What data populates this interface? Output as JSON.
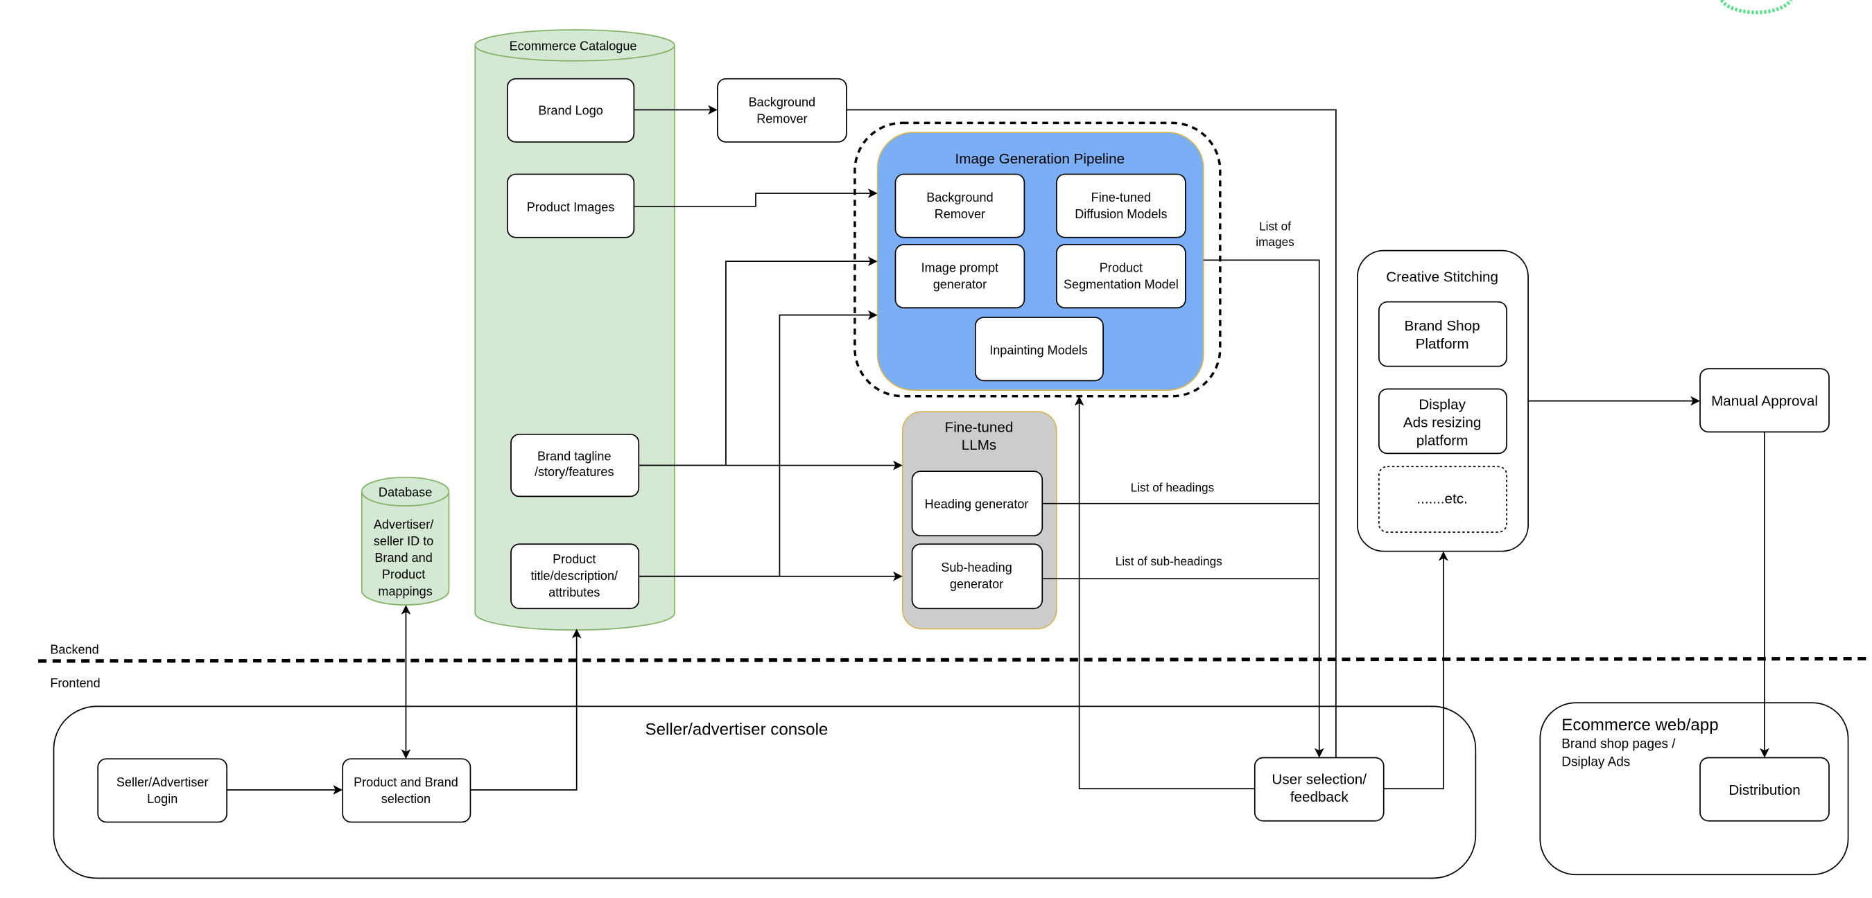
{
  "colors": {
    "catalogue_fill": "#d5e8d4",
    "catalogue_stroke": "#82b366",
    "pipeline_fill": "#7aaef5",
    "pipeline_stroke": "#d6b656",
    "llm_fill": "#cccccc",
    "llm_stroke": "#d6b656"
  },
  "catalogue": {
    "title": "Ecommerce Catalogue",
    "brand_logo": [
      "Brand Logo"
    ],
    "product_images": [
      "Product Images"
    ],
    "brand_tagline": [
      "Brand tagline",
      "/story/features"
    ],
    "product_title": [
      "Product",
      "title/description/",
      "attributes"
    ]
  },
  "bg_remover_outer": [
    "Background",
    "Remover"
  ],
  "pipeline": {
    "title": "Image Generation Pipeline",
    "bg_remover": [
      "Background",
      "Remover"
    ],
    "diffusion": [
      "Fine-tuned",
      "Diffusion Models"
    ],
    "prompt_gen": [
      "Image prompt",
      "generator"
    ],
    "segmentation": [
      "Product",
      "Segmentation Model"
    ],
    "inpainting": [
      "Inpainting Models"
    ]
  },
  "llms": {
    "title": [
      "Fine-tuned",
      "LLMs"
    ],
    "heading": [
      "Heading generator"
    ],
    "subheading": [
      "Sub-heading",
      "generator"
    ]
  },
  "database": {
    "title": "Database",
    "body": [
      "Advertiser/",
      "seller ID to",
      "Brand and",
      "Product",
      "mappings"
    ]
  },
  "edge_labels": {
    "images": [
      "List of",
      "images"
    ],
    "headings": "List of headings",
    "subheadings": "List of sub-headings"
  },
  "stitching": {
    "title": "Creative Stitching",
    "brand_shop": [
      "Brand Shop",
      "Platform"
    ],
    "display_ads": [
      "Display",
      "Ads resizing",
      "platform"
    ],
    "etc": ".......etc."
  },
  "manual_approval": "Manual Approval",
  "layers": {
    "backend": "Backend",
    "frontend": "Frontend"
  },
  "console": {
    "title": "Seller/advertiser console",
    "login": [
      "Seller/Advertiser",
      "Login"
    ],
    "selection": [
      "Product and Brand",
      "selection"
    ],
    "feedback": [
      "User selection/",
      "feedback"
    ]
  },
  "webapp": {
    "title": "Ecommerce web/app",
    "subtitle": [
      "Brand shop pages /",
      "Dsiplay Ads"
    ],
    "distribution": "Distribution"
  }
}
